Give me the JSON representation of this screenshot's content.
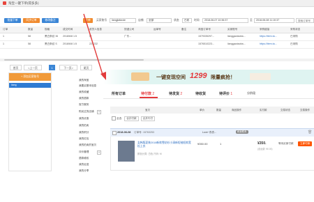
{
  "window": {
    "title": "淘宝—键下单(得多多)"
  },
  "toolbar": {
    "buttons": [
      {
        "label": "批量下单",
        "color": "#3b86d6"
      },
      {
        "label": "同步订单",
        "color": "#f08b2f"
      },
      {
        "label": "修改备注",
        "color": "#3b86d6"
      },
      {
        "label": "下单",
        "color": "#f08b2f"
      }
    ],
    "store_label": "买家账号",
    "store_value": "liangjiafaxde",
    "status_label": "店铺",
    "status_value": "全部",
    "state_label": "状态",
    "state_value": "已收",
    "date_label": "时间",
    "date_from": "2018-06-07 10:36:37",
    "date_sep": "至",
    "date_to": "2018-06-08 11:10:37",
    "search_placeholder": "搜索订单号"
  },
  "table": {
    "headers": [
      "订单",
      "数量",
      "规格",
      "成交时间",
      "收货人信息",
      "快递公司",
      "运单号",
      "备注",
      "淘宝订单号",
      "买家账号",
      "采购链接",
      "采购状态"
    ],
    "rows": [
      [
        "1",
        "58",
        "黑白条纹 36",
        "2018/6/8 1:5",
        "朴",
        "广东...",
        "",
        "",
        "1579335297...",
        "lianggaotaoba...",
        "https://item.ta...",
        "已采购"
      ],
      [
        "1",
        "58",
        "黑白条纹 S",
        "2018/6/8 1:5",
        "223232",
        "",
        "",
        "",
        "1576510223...",
        "lianggaotaoba...",
        "https://item.ta...",
        "已采购"
      ]
    ]
  },
  "pagination": {
    "first": "首页",
    "prev": "<上一页",
    "current": "1",
    "next": "下一页>",
    "last": "尾页"
  },
  "left_panel": {
    "add_button": "+ 添加买家账号",
    "account": "liang"
  },
  "side_menu": [
    "我的淘宝",
    "我要买基本信息",
    "我的收藏",
    "我的退款",
    "官方服务",
    "购买过的店铺",
    "我的优惠",
    "我的拍卖",
    "我的积分",
    "我的红包",
    "我的拍卖的宝贝",
    "评价管理",
    "退款维权",
    "我的足迹",
    "我的分享",
    "我要找"
  ],
  "banner": {
    "text": "一键变现空间",
    "amount": "1299",
    "suffix": "限量疯抢！"
  },
  "market_tabs": [
    {
      "label": "所有订单",
      "count": ""
    },
    {
      "label": "待付款",
      "count": "2"
    },
    {
      "label": "待发货",
      "count": "2"
    },
    {
      "label": "待收货",
      "count": ""
    },
    {
      "label": "待评价",
      "count": "1"
    },
    {
      "label": "分阶段",
      "count": ""
    }
  ],
  "market_header": [
    "宝贝",
    "单价",
    "数量",
    "商品操作",
    "实付款",
    "交易状态",
    "交易操作"
  ],
  "market_check": {
    "all": "全选",
    "merge": "合并付款",
    "merge2": "合并代付"
  },
  "order": {
    "date": "2018-06-08",
    "number_label": "订单号:",
    "number": "15763253",
    "shop": "Love~衣衣...",
    "tag": "和我联系"
  },
  "item": {
    "title": "女韩版夏装2018新款雪纺衫小清新短袖短款宽松上衣",
    "sub": "颜色分类: 白色 尺码: M",
    "price": "¥350.00",
    "qty": "1",
    "status": "等待买家付款",
    "pay_amount": "¥350.",
    "pay_note": "(含运费: ¥0.00)",
    "action": "立即付款"
  },
  "colors": {
    "accent_blue": "#3b86d6",
    "accent_orange": "#f08b2f",
    "tmall_red": "#e4393c",
    "arrow": "#e23b3b"
  }
}
